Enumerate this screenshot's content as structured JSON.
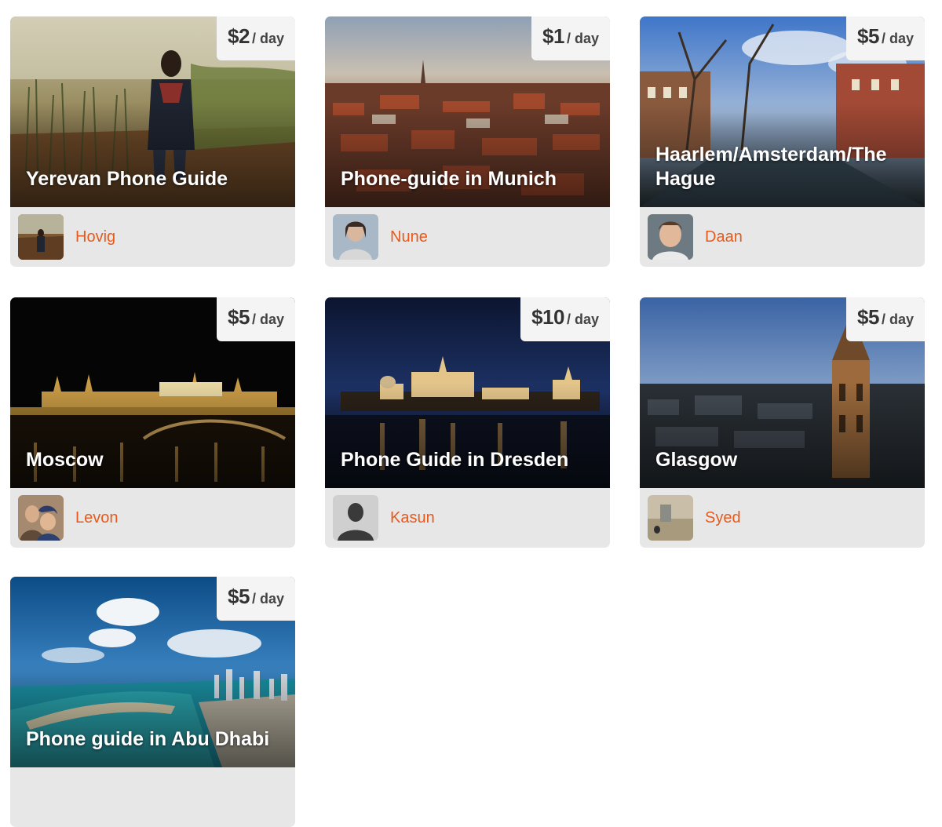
{
  "listings": [
    {
      "title": "Yerevan Phone Guide",
      "price": "$2",
      "price_unit": "/ day",
      "guide": "Hovig"
    },
    {
      "title": "Phone-guide in Munich",
      "price": "$1",
      "price_unit": "/ day",
      "guide": "Nune"
    },
    {
      "title": "Haarlem/Amsterdam/The Hague",
      "price": "$5",
      "price_unit": "/ day",
      "guide": "Daan"
    },
    {
      "title": "Moscow",
      "price": "$5",
      "price_unit": "/ day",
      "guide": "Levon"
    },
    {
      "title": "Phone Guide in Dresden",
      "price": "$10",
      "price_unit": "/ day",
      "guide": "Kasun"
    },
    {
      "title": "Glasgow",
      "price": "$5",
      "price_unit": "/ day",
      "guide": "Syed"
    },
    {
      "title": "Phone guide in Abu Dhabi",
      "price": "$5",
      "price_unit": "/ day",
      "guide": ""
    }
  ],
  "colors": {
    "guide_name": "#e8591c",
    "price_badge_bg": "#f4f4f4",
    "footer_bg": "#e7e7e7"
  }
}
